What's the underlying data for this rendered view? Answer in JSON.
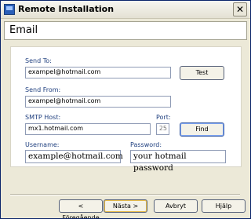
{
  "window": {
    "title": "Remote Installation",
    "close_glyph": "✕"
  },
  "header": {
    "section_title": "Email"
  },
  "form": {
    "send_to": {
      "label": "Send To:",
      "value": "exampel@hotmail.com"
    },
    "send_from": {
      "label": "Send From:",
      "value": "exampel@hotmail.com"
    },
    "smtp_host": {
      "label": "SMTP Host:",
      "value": "mx1.hotmail.com"
    },
    "port": {
      "label": "Port:",
      "value": "25"
    },
    "username": {
      "label": "Username:",
      "value": "example@hotmail.com"
    },
    "password": {
      "label": "Password:",
      "value": "your hotmail password"
    },
    "test_button": "Test",
    "find_button": "Find"
  },
  "footer": {
    "back": "< Föregående",
    "next": "Nästa >",
    "cancel": "Avbryt",
    "help": "Hjälp"
  },
  "icons": {
    "app": "installer-icon",
    "close": "close-icon"
  },
  "colors": {
    "label_text": "#1f3f7f",
    "window_bg": "#ece9d8"
  }
}
